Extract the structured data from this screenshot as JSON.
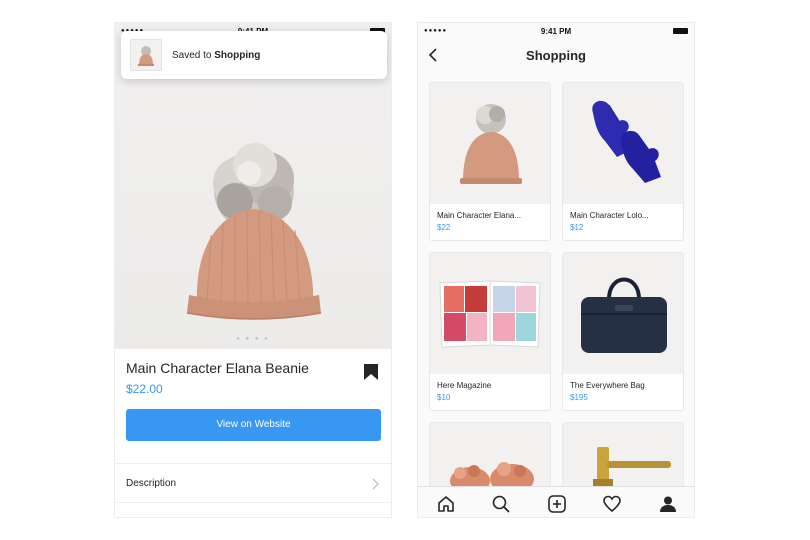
{
  "left_phone": {
    "status": {
      "dots": "●●●●●",
      "time": "9:41 PM"
    },
    "toast": {
      "prefix": "Saved to ",
      "collection": "Shopping"
    },
    "carousel_dots": "● ● ● ●",
    "product": {
      "title": "Main Character Elana Beanie",
      "price": "$22.00",
      "cta": "View on Website",
      "description_label": "Description"
    }
  },
  "right_phone": {
    "status": {
      "dots": "●●●●●",
      "time": "9:41 PM"
    },
    "title": "Shopping",
    "items": [
      {
        "name": "Main Character Elana...",
        "price": "$22",
        "icon": "beanie"
      },
      {
        "name": "Main Character Lolo...",
        "price": "$12",
        "icon": "mittens"
      },
      {
        "name": "Here Magazine",
        "price": "$10",
        "icon": "magazine"
      },
      {
        "name": "The Everywhere Bag",
        "price": "$195",
        "icon": "duffel-bag"
      },
      {
        "name": "",
        "price": "",
        "icon": "slippers"
      },
      {
        "name": "",
        "price": "",
        "icon": "hammer"
      }
    ],
    "tabs": [
      "home-icon",
      "search-icon",
      "add-icon",
      "heart-icon",
      "profile-icon"
    ]
  },
  "colors": {
    "accent": "#3897f0",
    "beanie": "#d49a7f",
    "mittens": "#2d2bb0",
    "bag": "#263045"
  }
}
